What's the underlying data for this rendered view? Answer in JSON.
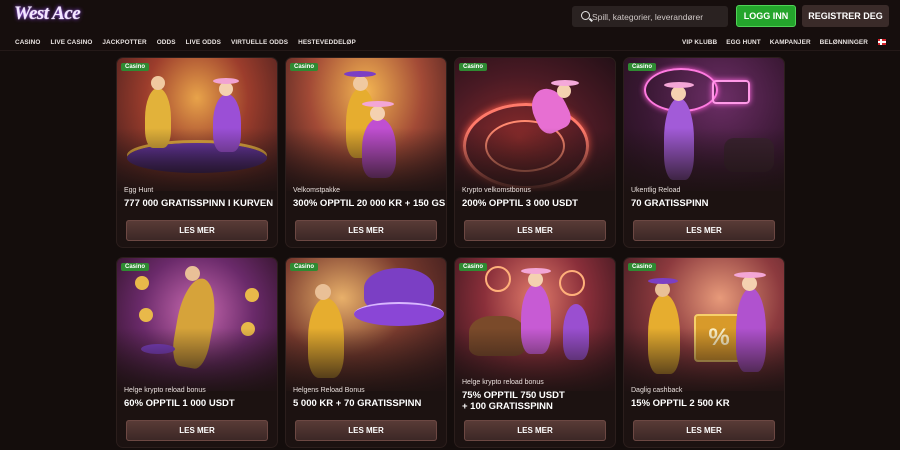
{
  "header": {
    "logo": "West Ace",
    "search_placeholder": "Spill, kategorier, leverandører",
    "login_label": "LOGG INN",
    "register_label": "REGISTRER DEG"
  },
  "nav": {
    "left": [
      "CASINO",
      "LIVE CASINO",
      "JACKPOTTER",
      "ODDS",
      "LIVE ODDS",
      "VIRTUELLE ODDS",
      "HESTEVEDDELØP"
    ],
    "right": [
      "VIP KLUBB",
      "EGG HUNT",
      "KAMPANJER",
      "BELØNNINGER"
    ]
  },
  "cards": [
    {
      "badge": "Casino",
      "subtitle": "Egg Hunt",
      "title": "777 000 GRATISSPINN I KURVEN",
      "button": "LES MER"
    },
    {
      "badge": "Casino",
      "subtitle": "Velkomstpakke",
      "title": "300% OPPTIL 20 000 KR + 150 GS",
      "button": "LES MER"
    },
    {
      "badge": "Casino",
      "subtitle": "Krypto velkomstbonus",
      "title": "200% OPPTIL 3 000 USDT",
      "button": "LES MER"
    },
    {
      "badge": "Casino",
      "subtitle": "Ukentlig Reload",
      "title": "70 GRATISSPINN",
      "button": "LES MER"
    },
    {
      "badge": "Casino",
      "subtitle": "Helge krypto reload bonus",
      "title": "60% OPPTIL 1 000 USDT",
      "button": "LES MER"
    },
    {
      "badge": "Casino",
      "subtitle": "Helgens Reload Bonus",
      "title": "5 000 KR + 70 GRATISSPINN",
      "button": "LES MER"
    },
    {
      "badge": "Casino",
      "subtitle": "Helge krypto reload bonus",
      "title": "75% OPPTIL 750 USDT",
      "title2": "+ 100 GRATISSPINN",
      "button": "LES MER"
    },
    {
      "badge": "Casino",
      "subtitle": "Daglig cashback",
      "title": "15% OPPTIL 2 500 KR",
      "button": "LES MER"
    }
  ],
  "card_art": [
    "egg-hunt-carousel-art",
    "welcome-package-art",
    "crypto-roulette-art",
    "neon-cowgirl-art",
    "crypto-bitcoin-cowboy-art",
    "rockstar-cowboy-hat-art",
    "carousel-horse-art",
    "cashback-box-art"
  ]
}
